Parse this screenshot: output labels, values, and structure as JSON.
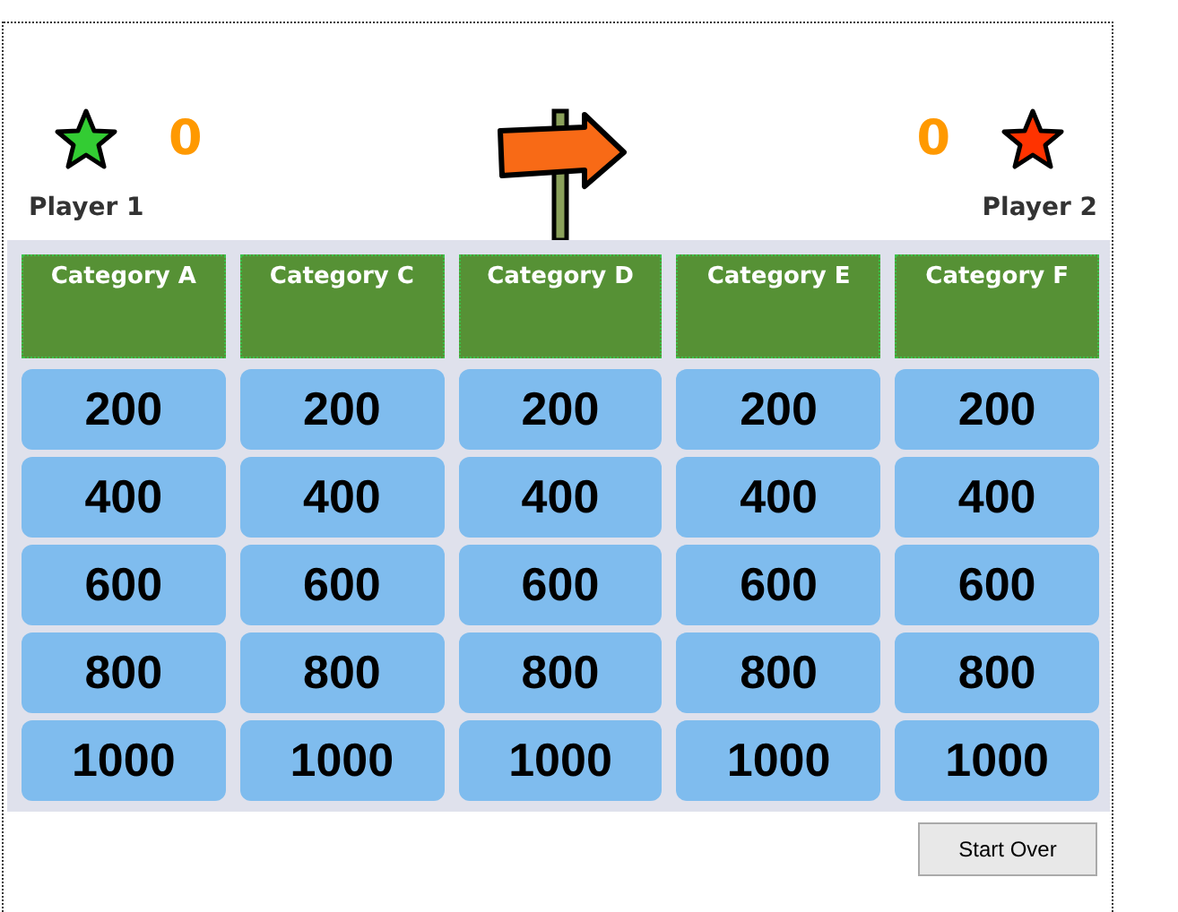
{
  "players": [
    {
      "name": "Player 1",
      "score": "0",
      "color": "#33cc33"
    },
    {
      "name": "Player 2",
      "score": "0",
      "color": "#ff3300"
    }
  ],
  "board": {
    "categories": [
      {
        "title": "Category A",
        "values": [
          "200",
          "400",
          "600",
          "800",
          "1000"
        ]
      },
      {
        "title": "Category C",
        "values": [
          "200",
          "400",
          "600",
          "800",
          "1000"
        ]
      },
      {
        "title": "Category D",
        "values": [
          "200",
          "400",
          "600",
          "800",
          "1000"
        ]
      },
      {
        "title": "Category E",
        "values": [
          "200",
          "400",
          "600",
          "800",
          "1000"
        ]
      },
      {
        "title": "Category F",
        "values": [
          "200",
          "400",
          "600",
          "800",
          "1000"
        ]
      }
    ]
  },
  "buttons": [
    {
      "label": "Start Over"
    }
  ]
}
